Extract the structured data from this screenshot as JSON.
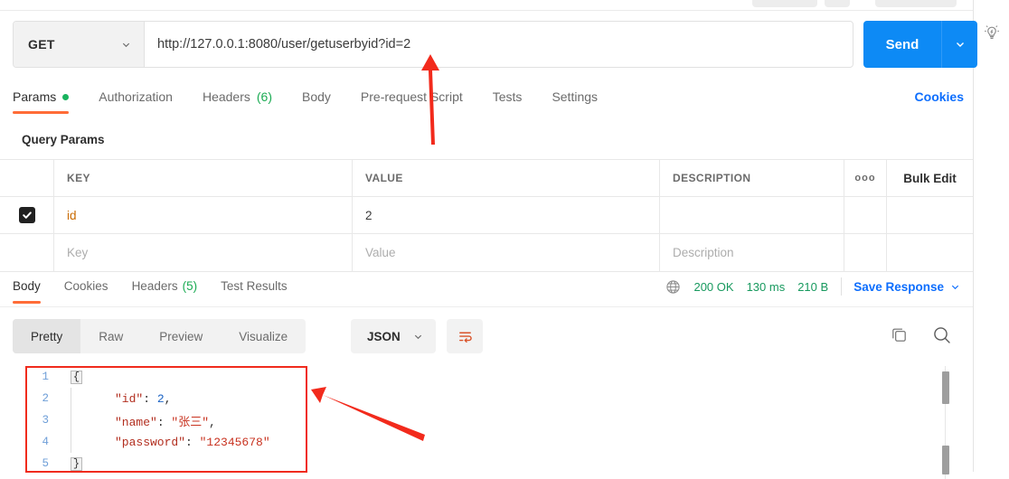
{
  "request": {
    "method": "GET",
    "url": "http://127.0.0.1:8080/user/getuserbyid?id=2",
    "send_label": "Send",
    "cookies_label": "Cookies",
    "tabs": [
      {
        "label": "Params",
        "dot": true,
        "active": true
      },
      {
        "label": "Authorization",
        "active": false
      },
      {
        "label": "Headers",
        "count": "(6)",
        "active": false
      },
      {
        "label": "Body",
        "active": false
      },
      {
        "label": "Pre-request Script",
        "active": false
      },
      {
        "label": "Tests",
        "active": false
      },
      {
        "label": "Settings",
        "active": false
      }
    ],
    "section_title": "Query Params",
    "table": {
      "headers": [
        "KEY",
        "VALUE",
        "DESCRIPTION"
      ],
      "dots_label": "ooo",
      "bulk_edit_label": "Bulk Edit",
      "rows": [
        {
          "checked": true,
          "key": "id",
          "value": "2",
          "description": ""
        }
      ],
      "placeholder_row": {
        "key": "Key",
        "value": "Value",
        "description": "Description"
      }
    }
  },
  "response": {
    "tabs": [
      {
        "label": "Body",
        "active": true
      },
      {
        "label": "Cookies",
        "active": false
      },
      {
        "label": "Headers",
        "count": "(5)",
        "active": false
      },
      {
        "label": "Test Results",
        "active": false
      }
    ],
    "status": "200 OK",
    "time": "130 ms",
    "size": "210 B",
    "save_label": "Save Response",
    "format_tabs": [
      {
        "label": "Pretty",
        "active": true
      },
      {
        "label": "Raw",
        "active": false
      },
      {
        "label": "Preview",
        "active": false
      },
      {
        "label": "Visualize",
        "active": false
      }
    ],
    "language": "JSON",
    "body_lines": [
      {
        "num": "1",
        "fold": "{",
        "text": ""
      },
      {
        "num": "2",
        "fold": null,
        "parts": [
          {
            "t": "\"id\"",
            "c": "jkey"
          },
          {
            "t": ": ",
            "c": "jpunc"
          },
          {
            "t": "2",
            "c": "jnum"
          },
          {
            "t": ",",
            "c": "jpunc"
          }
        ]
      },
      {
        "num": "3",
        "fold": null,
        "parts": [
          {
            "t": "\"name\"",
            "c": "jkey"
          },
          {
            "t": ": ",
            "c": "jpunc"
          },
          {
            "t": "\"张三\"",
            "c": "jstr"
          },
          {
            "t": ",",
            "c": "jpunc"
          }
        ]
      },
      {
        "num": "4",
        "fold": null,
        "parts": [
          {
            "t": "\"password\"",
            "c": "jkey"
          },
          {
            "t": ": ",
            "c": "jpunc"
          },
          {
            "t": "\"12345678\"",
            "c": "jstr"
          }
        ]
      },
      {
        "num": "5",
        "fold": "}",
        "text": ""
      }
    ]
  },
  "icons": {
    "lightbulb": "lightbulb-icon",
    "globe": "globe-icon",
    "copy": "copy-icon",
    "search": "search-icon",
    "wrap": "word-wrap-icon"
  },
  "colors": {
    "accent_orange": "#ff6c37",
    "send_blue": "#0d8af5",
    "link_blue": "#0d6efd",
    "status_green": "#17995e",
    "annotation_red": "#f02b1d"
  }
}
